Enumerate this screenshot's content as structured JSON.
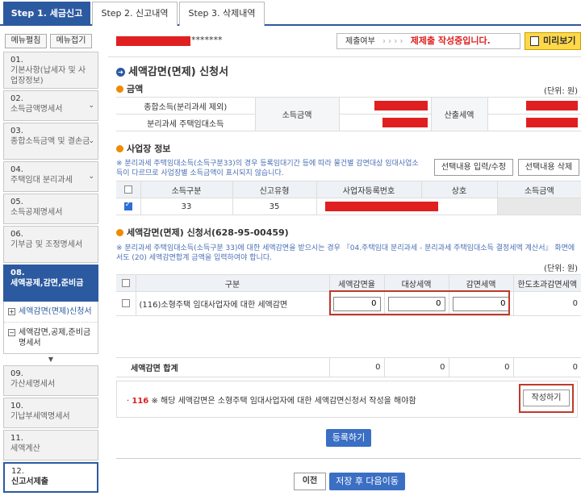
{
  "tabs": [
    {
      "label": "Step 1. 세금신고",
      "active": true
    },
    {
      "label": "Step 2. 신고내역",
      "active": false
    },
    {
      "label": "Step 3. 삭제내역",
      "active": false
    }
  ],
  "sidebar": {
    "expand_label": "메뉴펼침",
    "collapse_label": "메뉴접기",
    "items": [
      {
        "num": "01.",
        "label": "기본사항(납세자 및 사업장정보)"
      },
      {
        "num": "02.",
        "label": "소득금액명세서"
      },
      {
        "num": "03.",
        "label": "종합소득금액 및 결손금"
      },
      {
        "num": "04.",
        "label": "주택임대 분리과세"
      },
      {
        "num": "05.",
        "label": "소득공제명세서"
      },
      {
        "num": "06.",
        "label": "기부금 및 조정명세서"
      },
      {
        "num": "08.",
        "label": "세액공제,감면,준비금"
      },
      {
        "num": "09.",
        "label": "가산세명세서"
      },
      {
        "num": "10.",
        "label": "기납부세액명세서"
      },
      {
        "num": "11.",
        "label": "세액계산"
      },
      {
        "num": "12.",
        "label": "신고서제출"
      }
    ],
    "sub_items": [
      {
        "label": "세액감면(면제)신청서",
        "marker": "+"
      },
      {
        "label": "세액감면,공제,준비금명세서",
        "marker": "−"
      }
    ]
  },
  "topbar": {
    "masked_suffix": "*******",
    "status_label": "제출여부",
    "status_arrows": "› › › ›",
    "status_value": "제제출 작성중입니다.",
    "preview_label": "미리보기"
  },
  "doc_title": "세액감면(면제) 신청서",
  "amount_section": {
    "title": "금액",
    "unit": "(단위: 원)",
    "row1_label": "종합소득(분리과세 제외)",
    "row2_label": "분리과세 주택임대소득",
    "income_label": "소득금액",
    "tax_label": "산출세액"
  },
  "business_section": {
    "title": "사업장 정보",
    "note": "※ 분리과세 주택임대소득(소득구분33)의 경우 등록임대기간 등에 따라 물건별 감면대상 임대사업소득이 다르므로 사업장별 소득금액이 표시되지 않습니다.",
    "edit_button": "선택내용 입력/수정",
    "delete_button": "선택내용 삭제",
    "headers": [
      "소득구분",
      "신고유형",
      "사업자등록번호",
      "상호",
      "소득금액"
    ],
    "row": {
      "income_type": "33",
      "report_type": "35"
    }
  },
  "application_section": {
    "title": "세액감면(면제) 신청서(628-95-00459)",
    "note": "※ 분리과세 주택임대소득(소득구분 33)에 대한 세액감면을 받으시는 경우 『04.주택임대 분리과세 - 분리과세 주택임대소득 결정세액 계산서』 화면에서도 (20) 세액감면합계 금액을 입력하여야 합니다.",
    "unit": "(단위: 원)",
    "headers": [
      "구분",
      "세액감면율",
      "대상세액",
      "감면세액",
      "한도초과감면세액"
    ],
    "row": {
      "label": "(116)소형주택 임대사업자에 대한 세액감면",
      "rate": "0",
      "target": "0",
      "reduction": "0",
      "excess": "0"
    },
    "total": {
      "label": "세액감면 합계",
      "rate": "0",
      "target": "0",
      "reduction": "0",
      "excess": "0"
    }
  },
  "hint": {
    "bullet": "·",
    "code": "116",
    "text": "※ 해당 세액감면은 소형주택 임대사업자에 대한 세액감면신청서 작성을 해야함",
    "write_button": "작성하기"
  },
  "register_button": "등록하기",
  "prev_button": "이전",
  "save_next_button": "저장 후 다음이동",
  "colors": {
    "primary": "#2c5aa0",
    "accent_red": "#e02020",
    "highlight_border": "#c0392b",
    "preview_yellow": "#ffd84a"
  }
}
